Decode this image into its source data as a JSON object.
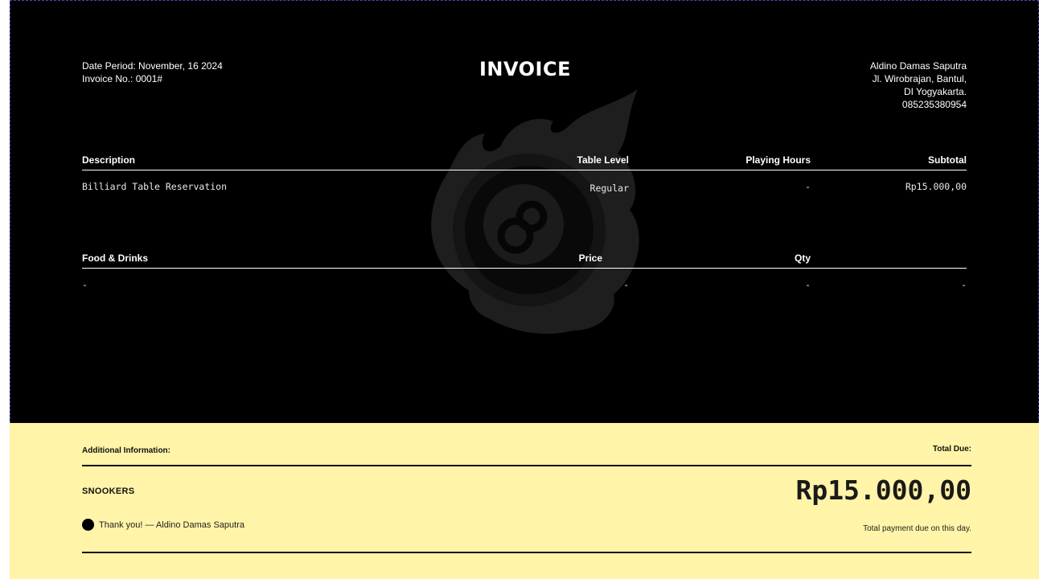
{
  "header": {
    "date_period": "Date Period: November, 16 2024",
    "invoice_no": "Invoice No.: 0001#",
    "title": "INVOICE",
    "company": {
      "name": "Aldino Damas Saputra",
      "address_line1": "Jl. Wirobrajan, Bantul,",
      "address_line2": "DI Yogyakarta.",
      "phone": "085235380954"
    }
  },
  "reservation_table": {
    "columns": [
      "Description",
      "Table Level",
      "Playing Hours",
      "Subtotal"
    ],
    "rows": [
      [
        "Billiard Table Reservation",
        "Regular",
        "-",
        "Rp15.000,00"
      ]
    ]
  },
  "food_table": {
    "columns": [
      "Food & Drinks",
      "Price",
      "Qty",
      ""
    ],
    "rows": [
      [
        "-",
        "-",
        "-",
        "-"
      ]
    ]
  },
  "footer": {
    "additional_info_label": "Additional Information:",
    "total_due_label": "Total Due:",
    "brand": "SNOOKERS",
    "total_amount": "Rp15.000,00",
    "thanks": "Thank you! — Aldino Damas Saputra",
    "due_note": "Total payment due on this day.",
    "background_color": "#fff4a8"
  },
  "watermark_icon": "eight-ball-flame-icon"
}
